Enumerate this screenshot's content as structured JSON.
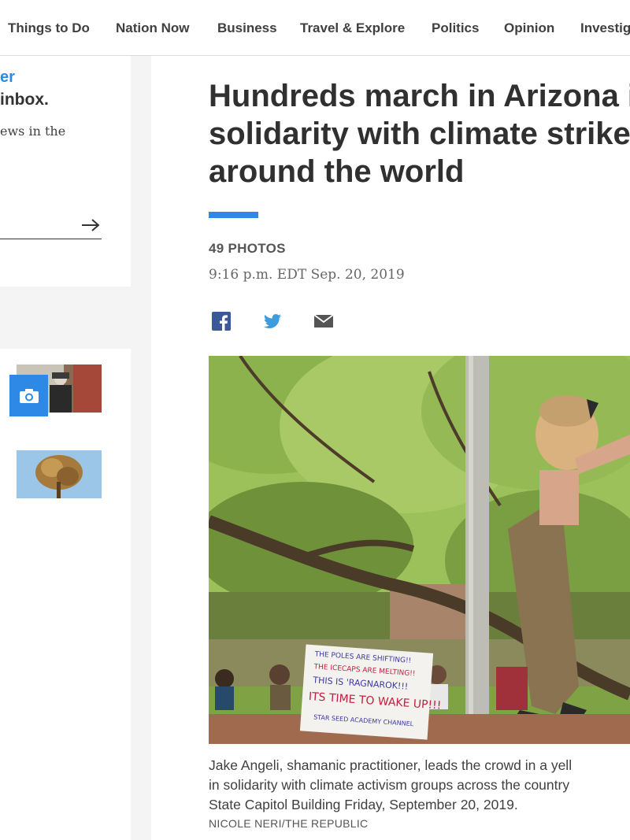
{
  "nav": {
    "items": [
      {
        "label": "Things to Do"
      },
      {
        "label": "Nation Now"
      },
      {
        "label": "Business"
      },
      {
        "label": "Travel & Explore"
      },
      {
        "label": "Politics"
      },
      {
        "label": "Opinion"
      },
      {
        "label": "Investig"
      }
    ]
  },
  "newsletter": {
    "line1": "er",
    "line2": "inbox.",
    "desc": "ews in the",
    "submit_icon": "arrow-right-icon"
  },
  "gallery_sidebar": {
    "camera_icon": "camera-icon"
  },
  "article": {
    "headline_lines": [
      "Hundreds march in Arizona in",
      "solidarity with climate strikes",
      "around the world"
    ],
    "photo_count": "49 PHOTOS",
    "timestamp": "9:16 p.m. EDT Sep. 20, 2019",
    "share": [
      {
        "icon": "facebook-icon",
        "color": "#3b5998"
      },
      {
        "icon": "twitter-icon",
        "color": "#3e9cdd"
      },
      {
        "icon": "email-icon",
        "color": "#555555"
      }
    ],
    "sign_text": [
      "THE POLES ARE SHIFTING!!",
      "THE ICECAPS ARE MELTING!!",
      "THIS IS 'RAGNAROK!!!",
      "ITS TIME TO WAKE UP!!!",
      "STAR SEED ACADEMY CHANNEL"
    ],
    "caption_lines": [
      "Jake Angeli, shamanic practitioner, leads the crowd in a yell",
      "in solidarity with climate activism groups across the country",
      "State Capitol Building Friday, September 20, 2019."
    ],
    "credit": "NICOLE NERI/THE REPUBLIC"
  },
  "colors": {
    "accent": "#2e89e6",
    "headline": "#303030"
  }
}
